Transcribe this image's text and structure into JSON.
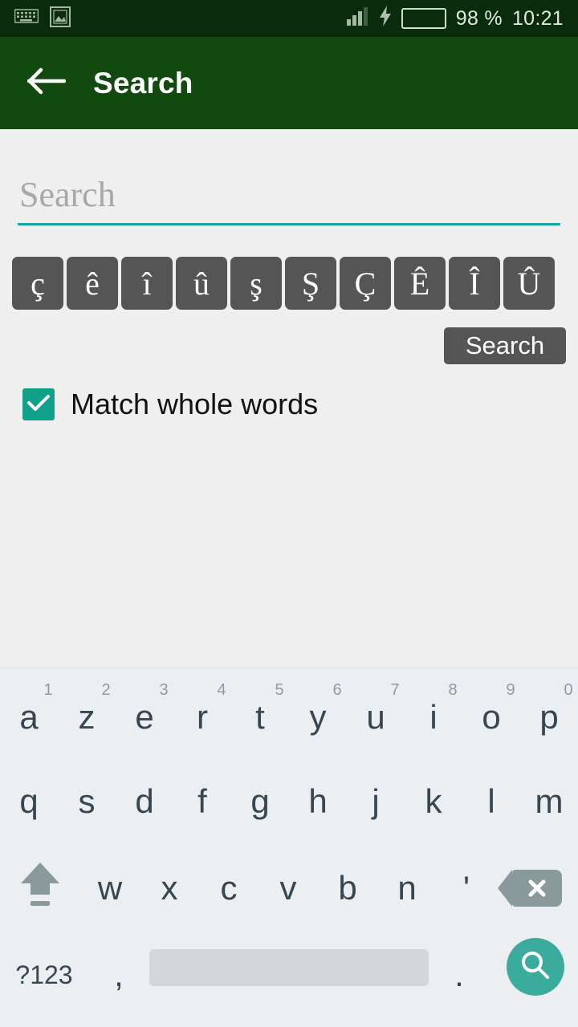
{
  "statusbar": {
    "icons": [
      "keyboard-icon",
      "image-icon"
    ],
    "signal_icon": "signal-bars-icon",
    "charging_icon": "lightning-bolt-icon",
    "battery_icon": "battery-icon",
    "battery_percent": "98 %",
    "time": "10:21",
    "bg_color": "#0b2c0c",
    "battery_fill_color": "#3bb54a"
  },
  "appbar": {
    "back_icon": "back-arrow-icon",
    "title": "Search",
    "bg_color": "#12490f"
  },
  "search": {
    "value": "",
    "placeholder": "Search",
    "underline_color": "#1aa3a3",
    "special_chars": [
      "ç",
      "ê",
      "î",
      "û",
      "ş",
      "Ş",
      "Ç",
      "Ê",
      "Î",
      "Û"
    ],
    "search_button_label": "Search",
    "chip_bg_color": "#555555"
  },
  "options": {
    "match_whole_words_label": "Match whole words",
    "match_whole_words_checked": true,
    "checkbox_color": "#11a08a",
    "check_icon": "checkmark-icon"
  },
  "keyboard": {
    "layout_name": "azerty",
    "bg_color": "#eceff1",
    "row1": [
      {
        "letter": "a",
        "alt": "1"
      },
      {
        "letter": "z",
        "alt": "2"
      },
      {
        "letter": "e",
        "alt": "3"
      },
      {
        "letter": "r",
        "alt": "4"
      },
      {
        "letter": "t",
        "alt": "5"
      },
      {
        "letter": "y",
        "alt": "6"
      },
      {
        "letter": "u",
        "alt": "7"
      },
      {
        "letter": "i",
        "alt": "8"
      },
      {
        "letter": "o",
        "alt": "9"
      },
      {
        "letter": "p",
        "alt": "0"
      }
    ],
    "row2": [
      {
        "letter": "q"
      },
      {
        "letter": "s"
      },
      {
        "letter": "d"
      },
      {
        "letter": "f"
      },
      {
        "letter": "g"
      },
      {
        "letter": "h"
      },
      {
        "letter": "j"
      },
      {
        "letter": "k"
      },
      {
        "letter": "l"
      },
      {
        "letter": "m"
      }
    ],
    "row3": [
      {
        "letter": "w"
      },
      {
        "letter": "x"
      },
      {
        "letter": "c"
      },
      {
        "letter": "v"
      },
      {
        "letter": "b"
      },
      {
        "letter": "n"
      },
      {
        "letter": "'"
      }
    ],
    "shift_icon": "shift-arrow-icon",
    "backspace_icon": "backspace-icon",
    "symbols_label": "?123",
    "comma_label": ",",
    "period_label": ".",
    "space_label": "",
    "enter_icon": "search-magnifier-icon",
    "enter_key_color": "#3aab9d"
  }
}
